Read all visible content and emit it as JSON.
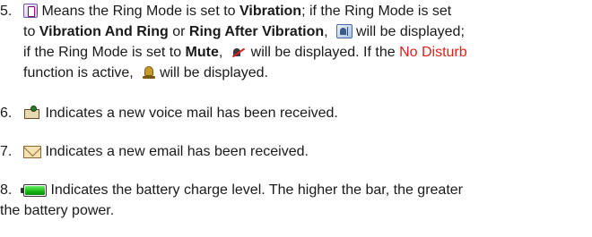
{
  "items": [
    {
      "num": "5.",
      "s1": "Means the Ring Mode is set to ",
      "b1": "Vibration",
      "s2": "; if the Ring Mode is set",
      "s3": "to ",
      "b2": "Vibration And Ring",
      "s4": " or ",
      "b3": "Ring After Vibration",
      "s5": ",",
      "s6": " will be displayed;",
      "s7": "if the Ring Mode is set to ",
      "b4": "Mute",
      "s8": ",",
      "s9": " will be displayed. If the ",
      "red": "No Disturb",
      "s10": "function is active,",
      "s11": " will be displayed."
    },
    {
      "num": "6.",
      "text": "Indicates a new voice mail has been received."
    },
    {
      "num": "7.",
      "text": "Indicates a new email has been received."
    },
    {
      "num": "8.",
      "text_line1": "Indicates the battery charge level. The higher the bar, the greater",
      "text_line2": "the battery power.",
      "battery_level": 1.0
    }
  ],
  "icons": {
    "vibration": "vibration-icon",
    "vibration_ring": "vibration-ring-icon",
    "mute": "mute-icon",
    "no_disturb": "no-disturb-icon",
    "voice_mail": "voice-mail-icon",
    "email": "email-icon",
    "battery": "battery-icon"
  },
  "colors": {
    "text": "#1a1a1a",
    "highlight": "#e0201a",
    "battery_fill": "#14b814"
  }
}
